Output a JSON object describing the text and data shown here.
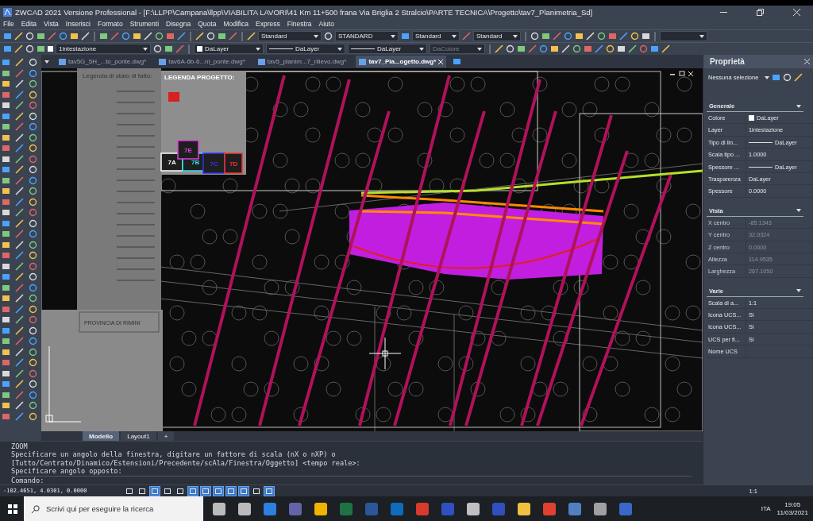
{
  "window": {
    "title": "ZWCAD 2021 Versione Professional - [F:\\LLPP\\Campana\\llpp\\VIABILITA LAVORI\\41 Km 11+500 frana Via Briglia 2 Stralcio\\PARTE TECNICA\\Progetto\\tav7_Planimetria_Sd]"
  },
  "menu": [
    "File",
    "Edita",
    "Vista",
    "Inserisci",
    "Formato",
    "Strumenti",
    "Disegna",
    "Quota",
    "Modifica",
    "Express",
    "Finestra",
    "Aiuto"
  ],
  "toolbar": {
    "text_style": "Standard",
    "dim_style": "STANDARD",
    "table_style": "Standard",
    "mleader_style": "Standard",
    "layer": "1intestazione",
    "color_setting": "DaLayer",
    "linetype": "DaLayer",
    "lineweight": "DaLayer",
    "plot_style": {
      "value": "DaColore",
      "disabled": true
    }
  },
  "tabs": [
    {
      "label": "tav5G_5H_...to_ponte.dwg*",
      "selected": false
    },
    {
      "label": "tav6A-6b-6...ni_ponte.dwg*",
      "selected": false
    },
    {
      "label": "tav5_planim...7_rilievo.dwg*",
      "selected": false
    },
    {
      "label": "tav7_Pla...ogetto.dwg*",
      "selected": true
    }
  ],
  "drawing": {
    "legend_title": "Legenda di stato di fatto:",
    "project_legend_title": "LEGENDA PROGETTO:",
    "sheet_labels": [
      "7E",
      "7A",
      "7B",
      "7C",
      "7D"
    ],
    "authority": "PROVINCIA DI RIMINI"
  },
  "layout_tabs": [
    {
      "label": "Modello",
      "selected": true
    },
    {
      "label": "Layout1",
      "selected": false
    }
  ],
  "add_layout": "+",
  "command": {
    "history": [
      "ZOOM",
      "Specificare un angolo della finestra, digitare un fattore di scala (nX o nXP) o",
      "[Tutto/Centrato/Dinamico/Estensioni/Precedente/scAla/Finestra/Oggetto] <tempo reale>:",
      "Specificare angolo opposto:"
    ],
    "prompt": "Comando:"
  },
  "status_bar": {
    "coordinates": "-102.4651, 4.0301, 0.0000",
    "toggles": [
      {
        "on": false
      },
      {
        "on": false
      },
      {
        "on": true
      },
      {
        "on": false
      },
      {
        "on": false
      },
      {
        "on": true
      },
      {
        "on": true
      },
      {
        "on": true
      },
      {
        "on": true
      },
      {
        "on": true
      },
      {
        "on": false
      },
      {
        "on": true
      }
    ],
    "annotation_scale": "1:1"
  },
  "properties": {
    "title": "Proprietà",
    "selection": "Nessuna selezione",
    "sections": [
      {
        "title": "Generale",
        "rows": [
          {
            "label": "Colore",
            "value": "DaLayer",
            "kind": "color",
            "disabled": false
          },
          {
            "label": "Layer",
            "value": "1intestazione",
            "kind": "text",
            "disabled": false
          },
          {
            "label": "Tipo di lin...",
            "value": "DaLayer",
            "kind": "line",
            "disabled": false
          },
          {
            "label": "Scala tipo ...",
            "value": "1.0000",
            "kind": "text",
            "disabled": false
          },
          {
            "label": "Spessore ...",
            "value": "DaLayer",
            "kind": "line",
            "disabled": false
          },
          {
            "label": "Trasparenza",
            "value": "DaLayer",
            "kind": "text",
            "disabled": false
          },
          {
            "label": "Spessore",
            "value": "0.0000",
            "kind": "text",
            "disabled": false
          }
        ]
      },
      {
        "title": "Vista",
        "rows": [
          {
            "label": "X centro",
            "value": "-85.1343",
            "kind": "text",
            "disabled": true
          },
          {
            "label": "Y centro",
            "value": "32.0324",
            "kind": "text",
            "disabled": true
          },
          {
            "label": "Z centro",
            "value": "0.0000",
            "kind": "text",
            "disabled": true
          },
          {
            "label": "Altezza",
            "value": "114.9535",
            "kind": "text",
            "disabled": true
          },
          {
            "label": "Larghezza",
            "value": "267.1050",
            "kind": "text",
            "disabled": true
          }
        ]
      },
      {
        "title": "Varie",
        "rows": [
          {
            "label": "Scala di a...",
            "value": "1:1",
            "kind": "text",
            "disabled": false
          },
          {
            "label": "Icona UCS...",
            "value": "Sì",
            "kind": "text",
            "disabled": false
          },
          {
            "label": "Icona UCS...",
            "value": "Sì",
            "kind": "text",
            "disabled": false
          },
          {
            "label": "UCS per fi...",
            "value": "Sì",
            "kind": "text",
            "disabled": false
          },
          {
            "label": "Nome UCS",
            "disabled": false
          }
        ]
      }
    ]
  },
  "taskbar": {
    "search_placeholder": "Scrivi qui per eseguire la ricerca",
    "language": "ITA",
    "time": "19:05",
    "date": "11/03/2021"
  }
}
